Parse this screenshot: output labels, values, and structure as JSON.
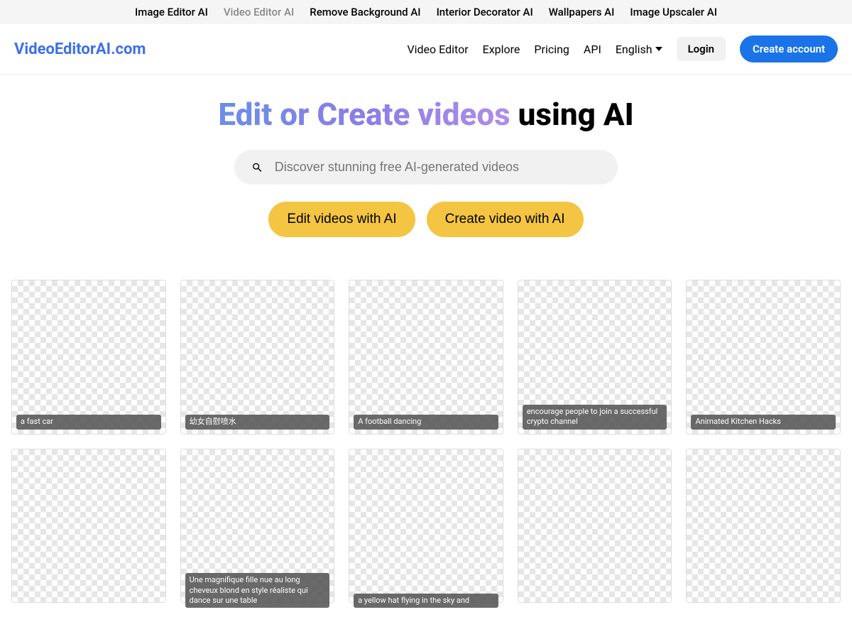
{
  "topbar": {
    "items": [
      {
        "label": "Image Editor AI",
        "active": false
      },
      {
        "label": "Video Editor AI",
        "active": true
      },
      {
        "label": "Remove Background AI",
        "active": false
      },
      {
        "label": "Interior Decorator AI",
        "active": false
      },
      {
        "label": "Wallpapers AI",
        "active": false
      },
      {
        "label": "Image Upscaler AI",
        "active": false
      }
    ]
  },
  "header": {
    "logo": "VideoEditorAI.com",
    "nav": {
      "video_editor": "Video Editor",
      "explore": "Explore",
      "pricing": "Pricing",
      "api": "API",
      "language": "English",
      "login": "Login",
      "create_account": "Create account"
    }
  },
  "hero": {
    "title_gradient": "Edit or Create videos",
    "title_suffix": " using AI",
    "search_placeholder": "Discover stunning free AI-generated videos",
    "cta_edit": "Edit videos with AI",
    "cta_create": "Create video with AI"
  },
  "gallery": {
    "row1": [
      {
        "caption": "a fast car"
      },
      {
        "caption": "幼女自慰喷水"
      },
      {
        "caption": "A football dancing"
      },
      {
        "caption": "encourage people to join a successful crypto channel"
      },
      {
        "caption": "Animated Kitchen Hacks"
      }
    ],
    "row2": [
      {
        "caption": ""
      },
      {
        "caption": "Une magnifique fille nue au long cheveux blond en style réaliste qui dance sur une table"
      },
      {
        "caption": "a yellow hat flying in the sky and"
      },
      {
        "caption": ""
      },
      {
        "caption": ""
      }
    ]
  }
}
